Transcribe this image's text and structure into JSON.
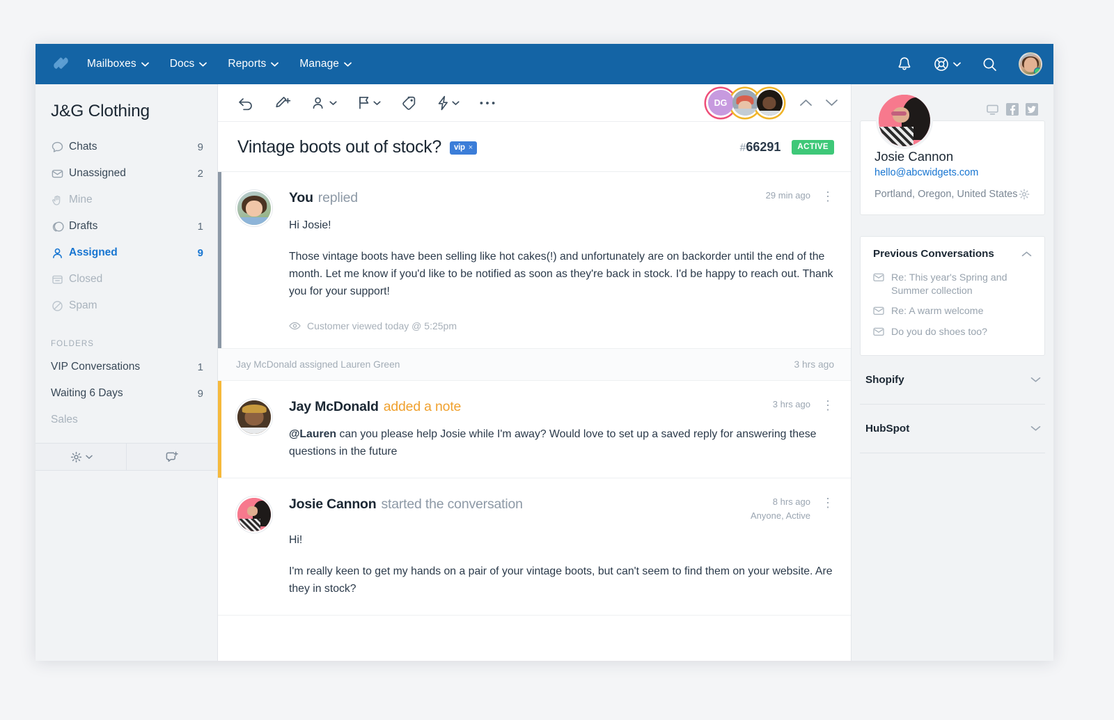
{
  "topnav": {
    "logo_icon": "helpscout-logo-icon",
    "items": [
      {
        "label": "Mailboxes",
        "icon": "chevron-down-icon"
      },
      {
        "label": "Docs",
        "icon": "chevron-down-icon"
      },
      {
        "label": "Reports",
        "icon": "chevron-down-icon"
      },
      {
        "label": "Manage",
        "icon": "chevron-down-icon"
      }
    ],
    "right_icons": [
      "bell-icon",
      "lifebuoy-help-icon",
      "search-icon"
    ],
    "account_avatar": "user-avatar"
  },
  "sidebar": {
    "mailbox_title": "J&G Clothing",
    "items": [
      {
        "label": "Chats",
        "count": "9",
        "icon": "chat-bubble-icon",
        "state": "normal"
      },
      {
        "label": "Unassigned",
        "count": "2",
        "icon": "envelope-icon",
        "state": "normal"
      },
      {
        "label": "Mine",
        "count": "",
        "icon": "hand-icon",
        "state": "muted"
      },
      {
        "label": "Drafts",
        "count": "1",
        "icon": "drafts-icon",
        "state": "normal"
      },
      {
        "label": "Assigned",
        "count": "9",
        "icon": "person-icon",
        "state": "active"
      },
      {
        "label": "Closed",
        "count": "",
        "icon": "archive-icon",
        "state": "muted"
      },
      {
        "label": "Spam",
        "count": "",
        "icon": "no-entry-icon",
        "state": "muted"
      }
    ],
    "folders_header": "FOLDERS",
    "folders": [
      {
        "label": "VIP Conversations",
        "count": "1",
        "state": "normal"
      },
      {
        "label": "Waiting 6 Days",
        "count": "9",
        "state": "normal"
      },
      {
        "label": "Sales",
        "count": "",
        "state": "muted"
      }
    ],
    "footer": {
      "settings_icon": "gear-icon",
      "settings_caret": "chevron-down-icon",
      "new_conversation_icon": "new-conversation-icon"
    }
  },
  "toolbar": {
    "buttons": [
      {
        "name": "reply-button",
        "icon": "reply-arrow-icon",
        "caret": false
      },
      {
        "name": "compose-button",
        "icon": "pencil-plus-icon",
        "caret": false
      },
      {
        "name": "assign-button",
        "icon": "person-icon",
        "caret": true
      },
      {
        "name": "status-button",
        "icon": "flag-icon",
        "caret": true
      },
      {
        "name": "tag-button",
        "icon": "tag-icon",
        "caret": false
      },
      {
        "name": "workflow-button",
        "icon": "lightning-bolt-icon",
        "caret": true
      },
      {
        "name": "more-options-button",
        "icon": "ellipsis-icon",
        "caret": false
      }
    ],
    "assignee_avatars": [
      {
        "initials": "DG",
        "ring": "#ee4f79",
        "bg": "#c084d8"
      },
      {
        "initials": "",
        "ring": "#f0b429",
        "bg": "#b9c3cd"
      },
      {
        "initials": "",
        "ring": "#f0b429",
        "bg": "#2a2118"
      }
    ],
    "prev_icon": "chevron-up-icon",
    "next_icon": "chevron-down-icon"
  },
  "conversation": {
    "title": "Vintage boots out of stock?",
    "tag": {
      "label": "vip",
      "close": "×"
    },
    "hash": "#",
    "number": "66291",
    "status": "ACTIVE"
  },
  "messages": [
    {
      "type": "reply",
      "author": "You",
      "action": "replied",
      "time": "29 min ago",
      "subtext": "",
      "paragraphs": [
        "Hi Josie!",
        "Those vintage boots have been selling like hot cakes(!) and unfortunately are on backorder until the end of the month. Let me know if you'd like to be notified as soon as they're back in stock. I'd be happy to reach out. Thank you for your support!"
      ],
      "viewed_icon": "eye-icon",
      "viewed_text": "Customer viewed today @ 5:25pm",
      "kebab": "⋮"
    },
    {
      "type": "note",
      "author": "Jay McDonald",
      "action": "added a note",
      "time": "3 hrs ago",
      "subtext": "",
      "mention": "@Lauren",
      "paragraphs": [
        " can you please help Josie while I'm away? Would love to set up a saved reply for answering these questions in the future"
      ],
      "kebab": "⋮"
    },
    {
      "type": "start",
      "author": "Josie Cannon",
      "action": "started the conversation",
      "time": "8 hrs ago",
      "subtext": "Anyone, Active",
      "paragraphs": [
        "Hi!",
        "I'm really keen to get my hands on a pair of your vintage boots, but can't seem to find them on your website. Are they in stock?"
      ],
      "kebab": "⋮"
    }
  ],
  "assignment_event": {
    "text": "Jay McDonald assigned Lauren Green",
    "time": "3 hrs ago"
  },
  "right_panel": {
    "social_icons": [
      "monitor-icon",
      "facebook-icon",
      "twitter-icon"
    ],
    "customer": {
      "avatar": "customer-avatar",
      "name": "Josie Cannon",
      "email": "hello@abcwidgets.com",
      "location": "Portland, Oregon, United States",
      "settings_icon": "gear-icon"
    },
    "previous_conversations": {
      "title": "Previous Conversations",
      "caret": "chevron-up-icon",
      "items": [
        {
          "icon": "envelope-icon",
          "label": "Re: This year's Spring and Summer collection"
        },
        {
          "icon": "envelope-icon",
          "label": "Re: A warm welcome"
        },
        {
          "icon": "envelope-icon",
          "label": "Do you do shoes too?"
        }
      ]
    },
    "integrations": [
      {
        "name": "Shopify",
        "caret": "chevron-down-icon"
      },
      {
        "name": "HubSpot",
        "caret": "chevron-down-icon"
      }
    ]
  },
  "colors": {
    "brand_blue": "#1464a5",
    "accent_blue": "#1775d1",
    "status_green": "#3ec878",
    "note_amber": "#f6b93b",
    "tag_blue": "#3b7dd8"
  }
}
